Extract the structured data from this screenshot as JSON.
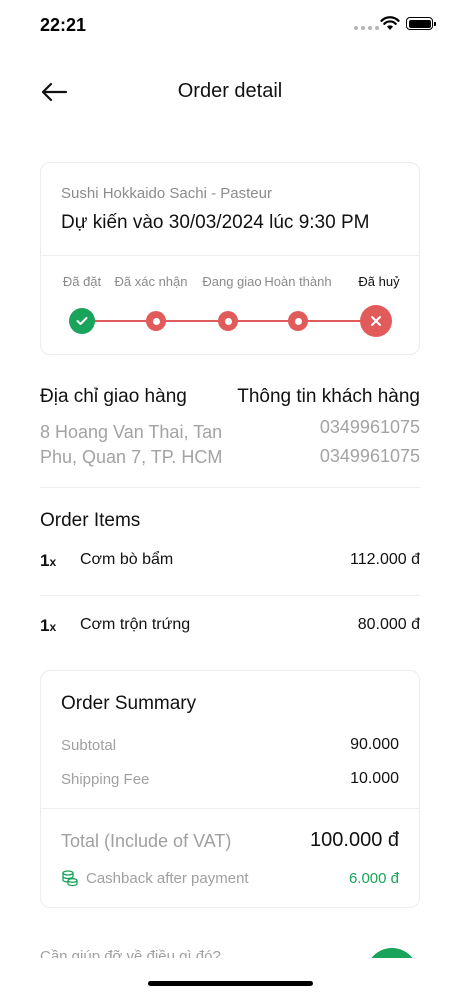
{
  "status_bar": {
    "time": "22:21"
  },
  "nav": {
    "title": "Order detail",
    "back_icon": "arrow-left-icon"
  },
  "order": {
    "store_name": "Sushi Hokkaido Sachi - Pasteur",
    "eta": "Dự kiến vào 30/03/2024 lúc 9:30 PM",
    "steps": [
      "Đã đặt",
      "Đã xác nhận",
      "Đang giao",
      "Hoàn thành",
      "Đã huỷ"
    ],
    "current_step": "Đã huỷ"
  },
  "delivery": {
    "address_title": "Địa chỉ giao hàng",
    "address_lines": [
      "8 Hoang Van Thai, Tan",
      "Phu, Quan 7, TP. HCM"
    ],
    "customer_title": "Thông tin khách hàng",
    "phones": [
      "0349961075",
      "0349961075"
    ]
  },
  "items": {
    "title": "Order Items",
    "list": [
      {
        "qty": "1",
        "qty_suffix": "x",
        "name": "Cơm bò bẩm",
        "price": "112.000 đ"
      },
      {
        "qty": "1",
        "qty_suffix": "x",
        "name": "Cơm trộn trứng",
        "price": "80.000 đ"
      }
    ]
  },
  "summary": {
    "title": "Order Summary",
    "subtotal_label": "Subtotal",
    "subtotal_value": "90.000",
    "shipping_label": "Shipping Fee",
    "shipping_value": "10.000",
    "total_label": "Total (Include of VAT)",
    "total_value": "100.000 đ",
    "cashback_label": "Cashback after payment",
    "cashback_value": "6.000 đ",
    "cashback_icon": "coins-icon"
  },
  "help": {
    "text": "Cần giúp đỡ về điều gì đó?"
  },
  "colors": {
    "green": "#1aa35a",
    "red": "#e25b5b",
    "muted": "#a0a0a0"
  }
}
